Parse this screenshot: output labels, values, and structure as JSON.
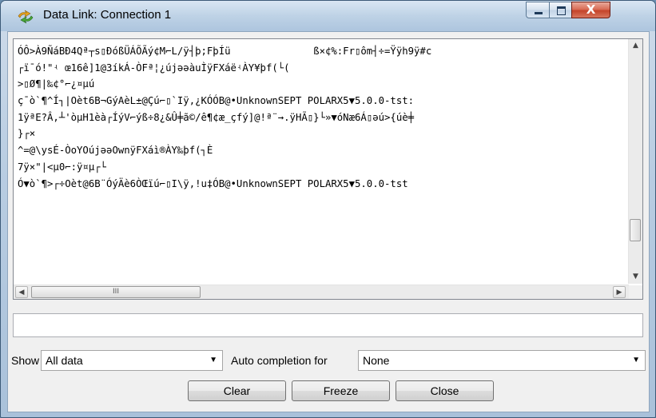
{
  "window": {
    "title": "Data Link: Connection 1",
    "icon": "data-link-icon",
    "controls": {
      "minimize_icon": "minimize-icon",
      "maximize_icon": "maximize-icon",
      "close_label": "X"
    }
  },
  "log": {
    "lines": [
      "ÓÔ>À9ÑáBÐ4Qª┬s▯ÐóßÜÁÕÃý¢M⌐L/ÿ┤þ;FþÍü              ß×¢%:Fr▯ôm┤÷=Ÿÿh9ÿ#c",
      "┌ï¯ó!\"ʵ œ16ê]1@3íkÁ-ÒFª¦¿újǝəàuÌÿFXáëʵÀY¥þf(└(",
      ">▯Ø¶|‰¢°⌐¿¤µú",
      "ç¯ò`¶^Í┐|Oèt6B¬GýAèL±@Çú⌐▯`Iÿ,¿KÓÓB@•UnknownSEPT POLARX5▼5.0.0-tst:",
      "1ÿªE?Â,┴'òµH1èà┌ÍýV⌐ýß÷8¿&Û╪ã©/ê¶¢æ_çfý]@!ª¨→.ÿHÃ▯}└»▼óNæ6Á▯ǝú>{úè╪",
      "}┌×",
      "^=@\\ysÉ-ÒoYOújǝəOwnÿFXáì®ÀY‰þf(┐È",
      "7ÿ×\"|<µ0⌐:ÿ¤µ┌└",
      "Ó▼ò`¶>┌÷Oèt@6B¨ÓýÄè6ÒŒïú⌐▯I\\ÿ,!u‡ÓB@•UnknownSEPT POLARX5▼5.0.0-tst"
    ],
    "scroll_up_icon": "▲",
    "scroll_down_icon": "▼",
    "scroll_left_icon": "◀",
    "scroll_right_icon": "▶",
    "hscroll_grip": "III"
  },
  "input": {
    "value": ""
  },
  "filters": {
    "show_label": "Show",
    "show_value": "All data",
    "autocompletion_label": "Auto completion for",
    "autocompletion_value": "None",
    "dropdown_arrow": "▼"
  },
  "buttons": {
    "clear": "Clear",
    "freeze": "Freeze",
    "close": "Close"
  }
}
